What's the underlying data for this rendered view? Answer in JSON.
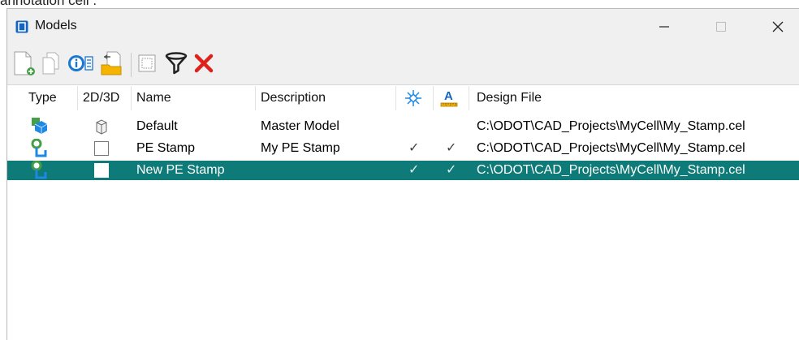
{
  "clipped_text": "annotation cell .",
  "window": {
    "title": "Models",
    "controls": [
      "minimize",
      "maximize",
      "close"
    ]
  },
  "toolbar": {
    "buttons": [
      {
        "icon": "new-model-icon"
      },
      {
        "icon": "copy-model-icon"
      },
      {
        "icon": "properties-icon"
      },
      {
        "icon": "import-icon"
      },
      {
        "icon": "select-icon"
      },
      {
        "icon": "filter-icon"
      },
      {
        "icon": "delete-icon"
      }
    ]
  },
  "table": {
    "columns": {
      "type": "Type",
      "dim": "2D/3D",
      "name": "Name",
      "description": "Description",
      "icon1": "snap-icon",
      "icon2": "annotation-scale-icon",
      "design_file": "Design File"
    },
    "rows": [
      {
        "type_icon": "master-model-icon",
        "dim_icon": "3d-cube-icon",
        "name": "Default",
        "description": "Master Model",
        "check1": "",
        "check2": "",
        "design_file": "C:\\ODOT\\CAD_Projects\\MyCell\\My_Stamp.cel",
        "selected": false
      },
      {
        "type_icon": "cell-model-icon",
        "dim_icon": "2d-square-icon",
        "name": "PE Stamp",
        "description": "My PE Stamp",
        "check1": "✓",
        "check2": "✓",
        "design_file": "C:\\ODOT\\CAD_Projects\\MyCell\\My_Stamp.cel",
        "selected": false
      },
      {
        "type_icon": "cell-model-icon",
        "dim_icon": "2d-square-icon",
        "name": "New PE Stamp",
        "description": "",
        "check1": "✓",
        "check2": "✓",
        "design_file": "C:\\ODOT\\CAD_Projects\\MyCell\\My_Stamp.cel",
        "selected": true
      }
    ]
  },
  "colors": {
    "selection": "#0f7b78",
    "delete_red": "#e0201b",
    "accent_blue": "#1e88e5"
  }
}
